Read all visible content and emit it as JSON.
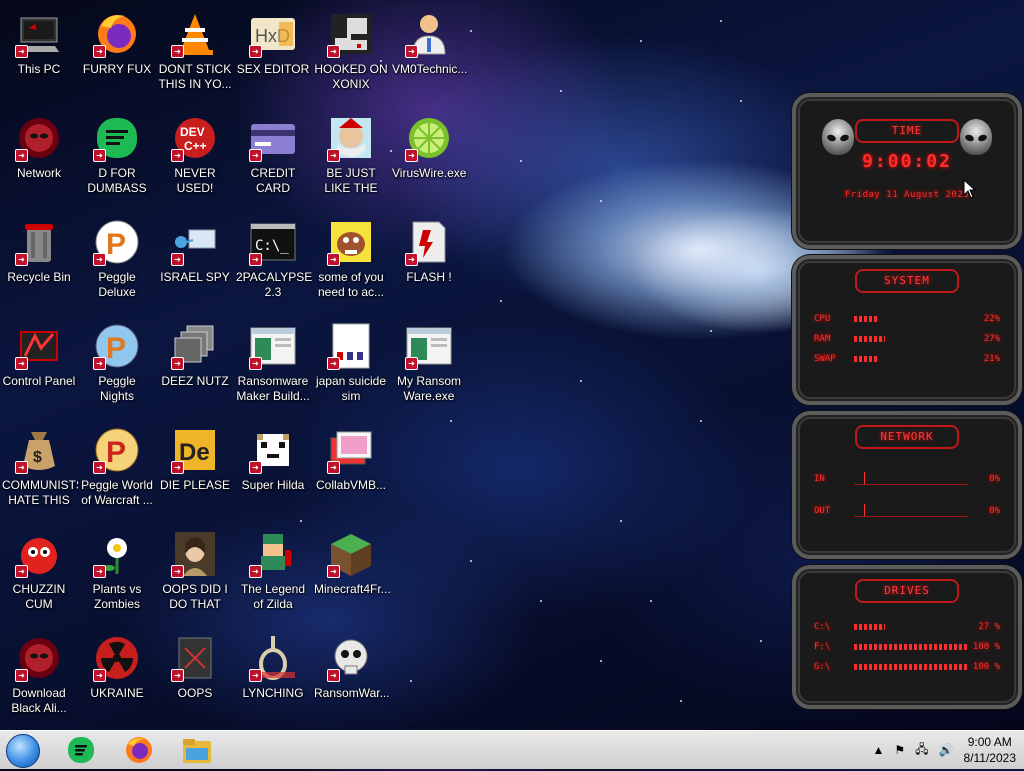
{
  "desktop": {
    "icons": [
      {
        "label": "This PC",
        "icon": "computer-icon"
      },
      {
        "label": "FURRY FUX",
        "icon": "firefox-icon"
      },
      {
        "label": "DONT STICK THIS IN YO...",
        "icon": "vlc-cone-icon"
      },
      {
        "label": "SEX EDITOR",
        "icon": "hex-editor-icon"
      },
      {
        "label": "HOOKED ON XONIX",
        "icon": "xonix-game-icon"
      },
      {
        "label": "VM0Technic...",
        "icon": "technician-icon"
      },
      {
        "label": "Network",
        "icon": "alien-globe-icon"
      },
      {
        "label": "D FOR DUMBASS",
        "icon": "green-chat-icon"
      },
      {
        "label": "NEVER USED!",
        "icon": "dev-cpp-icon"
      },
      {
        "label": "CREDIT CARD CHECKER",
        "icon": "credit-card-icon"
      },
      {
        "label": "BE JUST LIKE THE DUDE!",
        "icon": "dude-icon"
      },
      {
        "label": "VirusWire.exe",
        "icon": "lime-icon"
      },
      {
        "label": "Recycle Bin",
        "icon": "recycle-bin-icon"
      },
      {
        "label": "Peggle Deluxe",
        "icon": "peggle-icon"
      },
      {
        "label": "ISRAEL SPY",
        "icon": "spy-network-icon"
      },
      {
        "label": "2PACALYPSE 2.3",
        "icon": "terminal-icon"
      },
      {
        "label": "some of you need to ac...",
        "icon": "dog-icon"
      },
      {
        "label": "FLASH !",
        "icon": "flash-icon"
      },
      {
        "label": "Control Panel",
        "icon": "control-panel-icon"
      },
      {
        "label": "Peggle Nights Deluxe",
        "icon": "peggle-nights-icon"
      },
      {
        "label": "DEEZ NUTZ",
        "icon": "stacked-windows-icon"
      },
      {
        "label": "Ransomware Maker Build...",
        "icon": "window-app-icon"
      },
      {
        "label": "japan suicide sim",
        "icon": "document-icon"
      },
      {
        "label": "My Ransom Ware.exe",
        "icon": "window-app-icon"
      },
      {
        "label": "COMMUNISTS HATE THIS G...",
        "icon": "money-bag-icon"
      },
      {
        "label": "Peggle World of Warcraft ...",
        "icon": "peggle-wow-icon"
      },
      {
        "label": "DIE PLEASE",
        "icon": "de-icon"
      },
      {
        "label": "Super Hilda",
        "icon": "pixel-cat-icon"
      },
      {
        "label": "CollabVMB...",
        "icon": "collabvm-icon"
      },
      {
        "label": "CHUZZIN CUM",
        "icon": "chuzzle-icon"
      },
      {
        "label": "Plants vs Zombies",
        "icon": "pvz-flower-icon"
      },
      {
        "label": "OOPS DID I DO THAT",
        "icon": "portrait-icon"
      },
      {
        "label": "The Legend of Zilda",
        "icon": "pixel-hero-icon"
      },
      {
        "label": "Minecraft4Fr...",
        "icon": "grass-block-icon"
      },
      {
        "label": "Download Black Ali...",
        "icon": "alien-globe-icon"
      },
      {
        "label": "UKRAINE",
        "icon": "radiation-icon"
      },
      {
        "label": "OOPS",
        "icon": "dark-file-icon"
      },
      {
        "label": "LYNCHING",
        "icon": "rope-icon"
      },
      {
        "label": "RansomWar...",
        "icon": "skull-icon"
      }
    ]
  },
  "gadget": {
    "time_panel": {
      "title": "TIME",
      "time": "9:00:02",
      "date": "Friday 11 August 2023"
    },
    "system_panel": {
      "title": "SYSTEM",
      "rows": [
        {
          "label": "CPU",
          "value": "22%",
          "level": 0.22
        },
        {
          "label": "RAM",
          "value": "27%",
          "level": 0.27
        },
        {
          "label": "SWAP",
          "value": "21%",
          "level": 0.21
        }
      ]
    },
    "network_panel": {
      "title": "NETWORK",
      "rows": [
        {
          "label": "IN",
          "value": "0%"
        },
        {
          "label": "OUT",
          "value": "0%"
        }
      ]
    },
    "drives_panel": {
      "title": "DRIVES",
      "rows": [
        {
          "label": "C:\\",
          "value": "27 %",
          "level": 0.27
        },
        {
          "label": "F:\\",
          "value": "100 %",
          "level": 1.0
        },
        {
          "label": "G:\\",
          "value": "100 %",
          "level": 1.0
        }
      ]
    }
  },
  "taskbar": {
    "apps": [
      {
        "name": "start-orb",
        "icon": "start-orb-icon"
      },
      {
        "name": "chat-app",
        "icon": "green-chat-icon"
      },
      {
        "name": "firefox",
        "icon": "firefox-icon"
      },
      {
        "name": "file-explorer",
        "icon": "folder-icon"
      }
    ],
    "clock_time": "9:00 AM",
    "clock_date": "8/11/2023"
  }
}
